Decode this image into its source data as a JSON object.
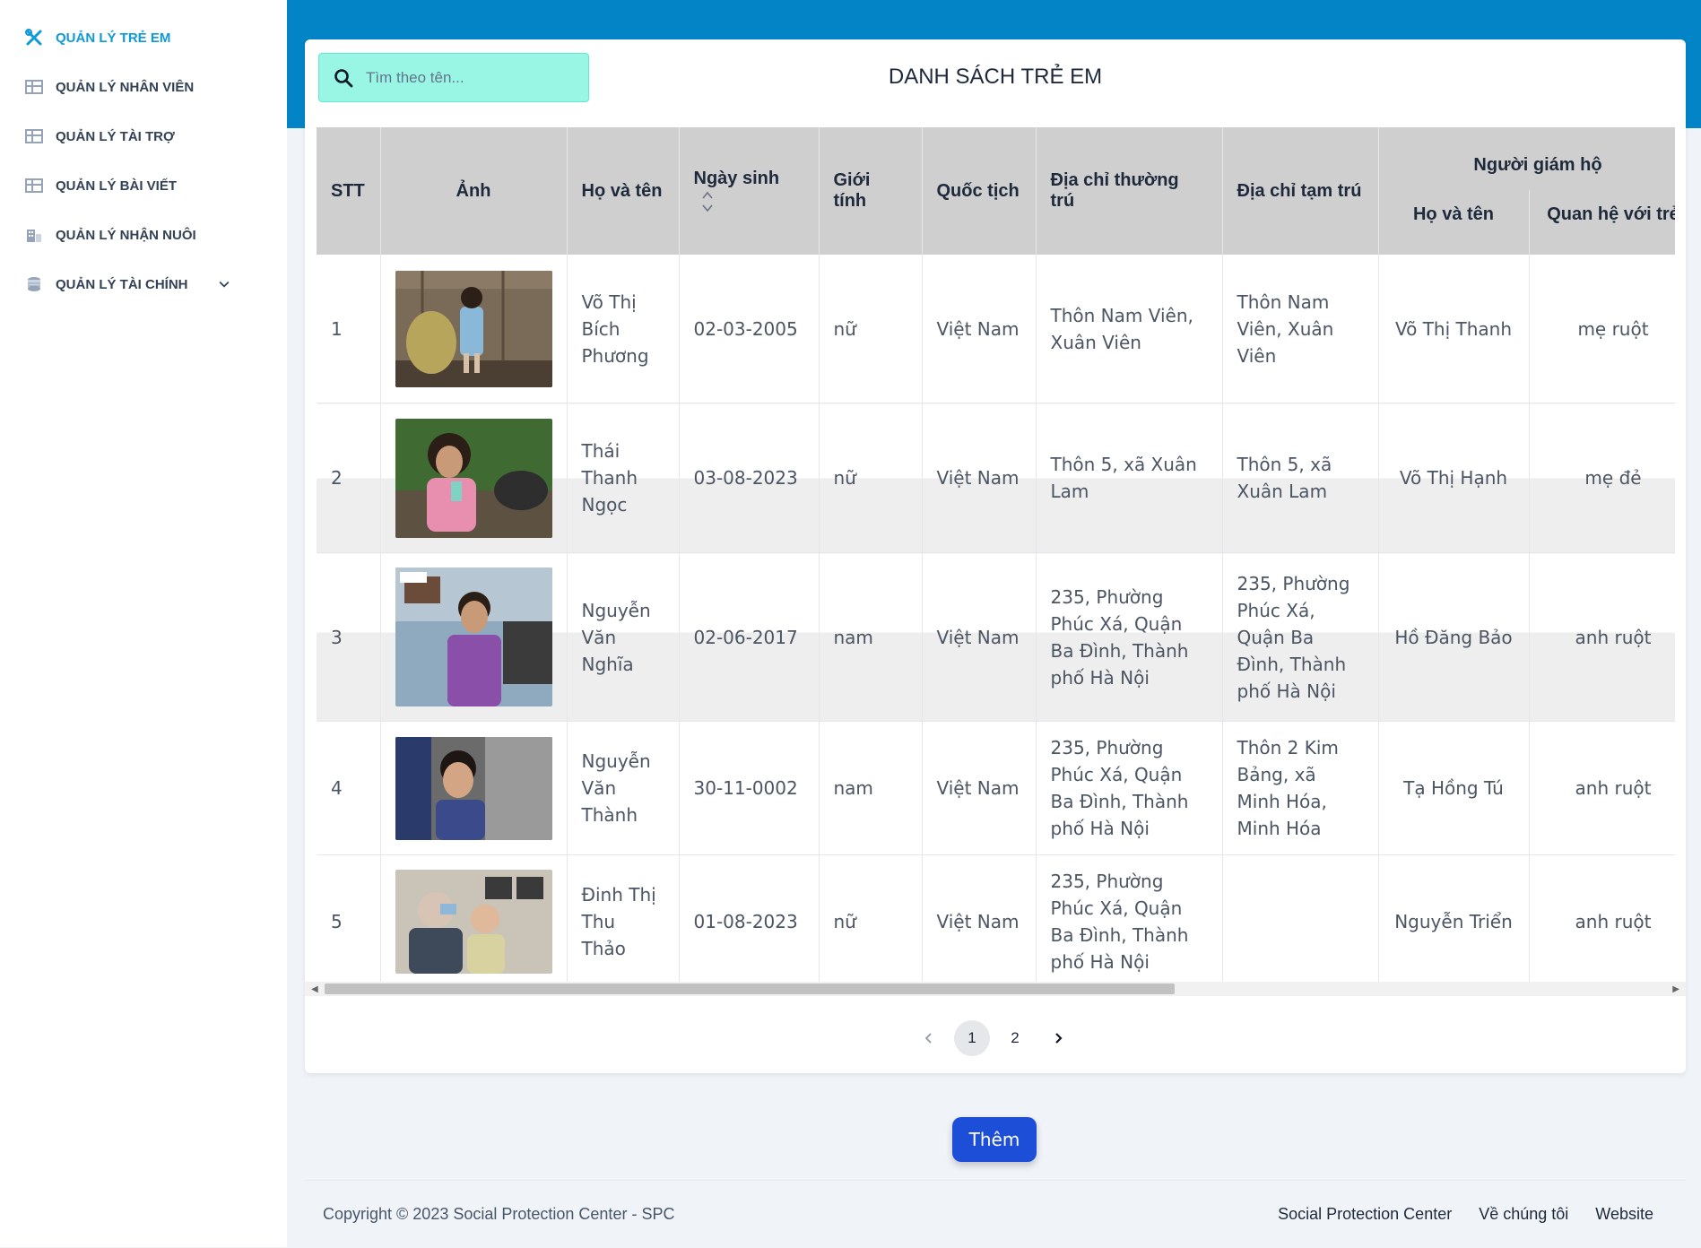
{
  "sidebar": {
    "items": [
      {
        "label": "QUẢN LÝ TRẺ EM",
        "icon": "tools-icon"
      },
      {
        "label": "QUẢN LÝ NHÂN VIÊN",
        "icon": "table-icon"
      },
      {
        "label": "QUẢN LÝ TÀI TRỢ",
        "icon": "table-icon"
      },
      {
        "label": "QUẢN LÝ BÀI VIẾT",
        "icon": "table-icon"
      },
      {
        "label": "QUẢN LÝ NHẬN NUÔI",
        "icon": "building-icon"
      },
      {
        "label": "QUẢN LÝ TÀI CHÍNH",
        "icon": "coins-icon"
      }
    ]
  },
  "search": {
    "placeholder": "Tìm theo tên..."
  },
  "title": "DANH SÁCH TRẺ EM",
  "table": {
    "headers": {
      "stt": "STT",
      "photo": "Ảnh",
      "name": "Họ và tên",
      "dob": "Ngày sinh",
      "gender": "Giới tính",
      "nationality": "Quốc tịch",
      "permanent_address": "Địa chỉ thường trú",
      "temporary_address": "Địa chỉ tạm trú",
      "guardian": "Người giám hộ",
      "guardian_name": "Họ và tên",
      "guardian_relation": "Quan hệ với trẻ"
    },
    "rows": [
      {
        "stt": "1",
        "name": "Võ Thị Bích Phương",
        "dob": "02-03-2005",
        "gender": "nữ",
        "nationality": "Việt Nam",
        "permanent_address": "Thôn Nam Viên, Xuân Viên",
        "temporary_address": "Thôn Nam Viên, Xuân Viên",
        "guardian_name": "Võ Thị Thanh",
        "guardian_relation": "mẹ ruột"
      },
      {
        "stt": "2",
        "name": "Thái Thanh Ngọc",
        "dob": "03-08-2023",
        "gender": "nữ",
        "nationality": "Việt Nam",
        "permanent_address": "Thôn 5, xã Xuân Lam",
        "temporary_address": "Thôn 5, xã Xuân Lam",
        "guardian_name": "Võ Thị Hạnh",
        "guardian_relation": "mẹ đẻ"
      },
      {
        "stt": "3",
        "name": "Nguyễn Văn Nghĩa",
        "dob": "02-06-2017",
        "gender": "nam",
        "nationality": "Việt Nam",
        "permanent_address": "235, Phường Phúc Xá, Quận Ba Đình, Thành phố Hà Nội",
        "temporary_address": "235, Phường Phúc Xá, Quận Ba Đình, Thành phố Hà Nội",
        "guardian_name": "Hồ Đăng Bảo",
        "guardian_relation": "anh ruột"
      },
      {
        "stt": "4",
        "name": "Nguyễn Văn Thành",
        "dob": "30-11-0002",
        "gender": "nam",
        "nationality": "Việt Nam",
        "permanent_address": "235, Phường Phúc Xá, Quận Ba Đình, Thành phố Hà Nội",
        "temporary_address": "Thôn 2 Kim Bảng, xã Minh Hóa, Minh Hóa",
        "guardian_name": "Tạ Hồng Tú",
        "guardian_relation": "anh ruột"
      },
      {
        "stt": "5",
        "name": "Đinh Thị Thu Thảo",
        "dob": "01-08-2023",
        "gender": "nữ",
        "nationality": "Việt Nam",
        "permanent_address": "235, Phường Phúc Xá, Quận Ba Đình, Thành phố Hà Nội",
        "temporary_address": "",
        "guardian_name": "Nguyễn Triển",
        "guardian_relation": "anh ruột"
      }
    ]
  },
  "pagination": {
    "pages": [
      "1",
      "2"
    ],
    "current": "1"
  },
  "add_button": "Thêm",
  "footer": {
    "copyright": "Copyright © 2023 Social Protection Center - SPC",
    "links": [
      "Social Protection Center",
      "Về chúng tôi",
      "Website"
    ]
  },
  "colors": {
    "header_band": "#0284c7",
    "search_bg": "#99f6e4",
    "add_button": "#1d4ed8",
    "active_nav": "#0e9ad6"
  }
}
